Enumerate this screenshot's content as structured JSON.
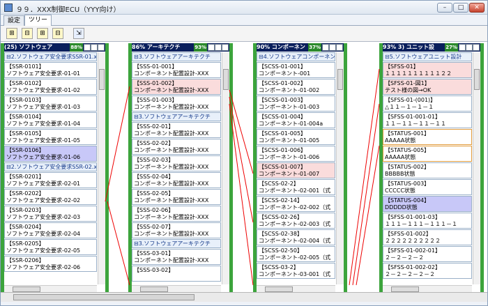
{
  "window": {
    "title": "９９．XXX制御ECU（YYY向け）",
    "min": "–",
    "max": "□",
    "close": "✕"
  },
  "tabs": [
    "設定",
    "ツリー"
  ],
  "toolbar": {
    "buttons": [
      "⊞",
      "⊟",
      "⊞",
      "⊟",
      "⇲"
    ]
  },
  "panes": [
    {
      "title": "(25) ソフトウェア",
      "pct": "88%",
      "rows": [
        {
          "g": 1,
          "t": "⊟2.ソフトウェア安全要求SSR-01.xls"
        },
        {
          "a": "【SSR-0101】",
          "b": "ソフトウェア安全要求-01-01"
        },
        {
          "a": "【SSR-0102】",
          "b": "ソフトウェア安全要求-01-02"
        },
        {
          "a": "【SSR-0103】",
          "b": "ソフトウェア安全要求-01-03"
        },
        {
          "a": "【SSR-0104】",
          "b": "ソフトウェア安全要求-01-04"
        },
        {
          "a": "【SSR-0105】",
          "b": "ソフトウェア安全要求-01-05"
        },
        {
          "a": "【SSR-0106】",
          "b": "ソフトウェア安全要求-01-06",
          "s": "sel"
        },
        {
          "g": 1,
          "t": "⊟2.ソフトウェア安全要求SSR-02.xls"
        },
        {
          "a": "【SSR-0201】",
          "b": "ソフトウェア安全要求-02-01"
        },
        {
          "a": "【SSR-0202】",
          "b": "ソフトウェア安全要求-02-02"
        },
        {
          "a": "【SSR-0203】",
          "b": "ソフトウェア安全要求-02-03"
        },
        {
          "a": "【SSR-0204】",
          "b": "ソフトウェア安全要求-02-04"
        },
        {
          "a": "【SSR-0205】",
          "b": "ソフトウェア安全要求-02-05"
        },
        {
          "a": "【SSR-0206】",
          "b": "ソフトウェア安全要求-02-06"
        }
      ]
    },
    {
      "title": "86% アーキテクチ",
      "pct": "93%",
      "rows": [
        {
          "g": 1,
          "t": "⊟3.ソフトウェアアーキテクチ"
        },
        {
          "a": "【SSS-01-001】",
          "b": "コンポーネント配置設計-XXX"
        },
        {
          "a": "【SSS-01-002】",
          "b": "コンポーネント配置設計-XXX",
          "s": "pink"
        },
        {
          "a": "【SSS-01-003】",
          "b": "コンポーネント配置設計-XXX"
        },
        {
          "g": 1,
          "t": "⊟3.ソフトウェアアーキテクチ"
        },
        {
          "a": "【SSS-02-01】",
          "b": "コンポーネント配置設計-XXX"
        },
        {
          "a": "【SSS-02-02】",
          "b": "コンポーネント配置設計-XXX"
        },
        {
          "a": "【SSS-02-03】",
          "b": "コンポーネント配置設計-XXX"
        },
        {
          "a": "【SSS-02-04】",
          "b": "コンポーネント配置設計-XXX"
        },
        {
          "a": "【SSS-02-05】",
          "b": "コンポーネント配置設計-XXX"
        },
        {
          "a": "【SSS-02-06】",
          "b": "コンポーネント配置設計-XXX"
        },
        {
          "a": "【SSS-02-07】",
          "b": "コンポーネント配置設計-XXX"
        },
        {
          "g": 1,
          "t": "⊟3.ソフトウェアアーキテクチ"
        },
        {
          "a": "【SSS-03-01】",
          "b": "コンポーネント配置設計-XXX"
        },
        {
          "a": "【SSS-03-02】",
          "b": ""
        }
      ]
    },
    {
      "title": "90% コンポーネン",
      "pct": "37%",
      "rows": [
        {
          "g": 1,
          "t": "⊟4.ソフトウェアコンポーネン"
        },
        {
          "a": "【SCSS-01-001】",
          "b": "コンポーネント-001"
        },
        {
          "a": "【SCSS-01-002】",
          "b": "コンポーネント-01-002"
        },
        {
          "a": "【SCSS-01-003】",
          "b": "コンポーネント-01-003"
        },
        {
          "a": "【SCSS-01-004】",
          "b": "コンポーネント-01-004a"
        },
        {
          "a": "【SCSS-01-005】",
          "b": "コンポーネント-01-005"
        },
        {
          "a": "【SCSS-01-006】",
          "b": "コンポーネント-01-006"
        },
        {
          "a": "【SCSS-01-007】",
          "b": "コンポーネント-01-007",
          "s": "pink"
        },
        {
          "a": "【SCSS-02-2】",
          "b": "コンポーネント-02-001（式"
        },
        {
          "a": "【SCSS-02-14】",
          "b": "コンポーネント-02-002（式"
        },
        {
          "a": "【SCSS-02-26】",
          "b": "コンポーネント-02-003（式"
        },
        {
          "a": "【SCSS-02-38】",
          "b": "コンポーネント-02-004（式"
        },
        {
          "a": "【SCSS-02-50】",
          "b": "コンポーネント-02-005（式"
        },
        {
          "a": "【SCSS-03-2】",
          "b": "コンポーネント-03-001（式"
        }
      ]
    },
    {
      "title": "93% 3) ユニット設",
      "pct": "27%",
      "rows": [
        {
          "g": 1,
          "t": "⊟5.ソフトウェアユニット設計"
        },
        {
          "a": "【SFSS-01】",
          "b": "１１１１１１１１１１２２",
          "s": "pink"
        },
        {
          "a": "【SFSS-01-図1】",
          "b": "テスト様の図→OK",
          "s": "pink"
        },
        {
          "a": "【SFSS-01-(001)】",
          "b": "△１１－１－１－１"
        },
        {
          "a": "【SFSS-01-001-01】",
          "b": "１１－１１－１１－１１"
        },
        {
          "a": "【STATUS-001】",
          "b": "AAAAA状態",
          "s": "orange"
        },
        {
          "a": "【STATUS-005】",
          "b": "AAAAA状態",
          "s": "orange"
        },
        {
          "a": "【STATUS-002】",
          "b": "BBBBB状態"
        },
        {
          "a": "【STATUS-003】",
          "b": "CCCCC状態"
        },
        {
          "a": "【STATUS-004】",
          "b": "DDDDD状態",
          "s": "sel"
        },
        {
          "a": "【SFSS-01-001-03】",
          "b": "１１１－１１１－１１１－１"
        },
        {
          "a": "【SFSS-01-002】",
          "b": "２２２２２２２２２２"
        },
        {
          "a": "【SFSS-01-002-01】",
          "b": "２－２－２－２"
        },
        {
          "a": "【SFSS-01-002-02】",
          "b": "２－２－２－２－２"
        }
      ]
    }
  ]
}
